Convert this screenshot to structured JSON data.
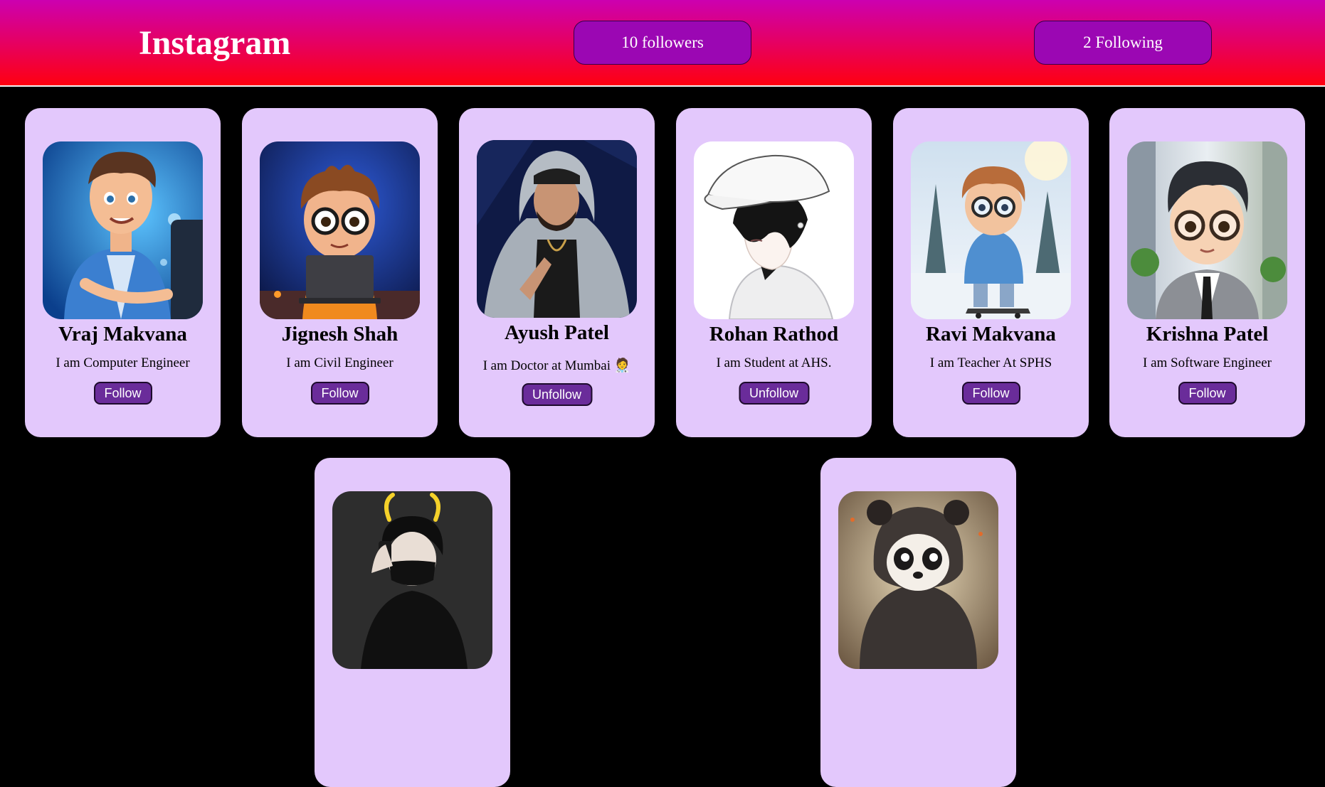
{
  "header": {
    "brand": "Instagram",
    "followers_label": "10 followers",
    "following_label": "2 Following",
    "gradient_top": "#cc00b0",
    "gradient_bottom": "#ff0010",
    "button_color": "#9b07b3"
  },
  "colors": {
    "page_background": "#000000",
    "card_background": "#e3c8fc",
    "action_button": "#6a2c9a"
  },
  "profiles": [
    {
      "name": "Vraj Makvana",
      "bio": "I am Computer Engineer",
      "action": "Follow",
      "avatar": "cartoon-man-laptop-avatar"
    },
    {
      "name": "Jignesh Shah",
      "bio": "I am Civil Engineer",
      "action": "Follow",
      "avatar": "cartoon-boy-glasses-laptop-avatar"
    },
    {
      "name": "Ayush Patel",
      "bio": "I am Doctor at Mumbai 🧑‍⚕️",
      "action": "Unfollow",
      "avatar": "man-grey-hoodie-cap-avatar"
    },
    {
      "name": "Rohan Rathod",
      "bio": "I am Student at AHS.",
      "action": "Unfollow",
      "avatar": "anime-boy-white-cap-avatar"
    },
    {
      "name": "Ravi Makvana",
      "bio": "I am Teacher At SPHS",
      "action": "Follow",
      "avatar": "cartoon-boy-skateboard-snow-avatar"
    },
    {
      "name": "Krishna Patel",
      "bio": "I am Software Engineer",
      "action": "Follow",
      "avatar": "cartoon-boy-suit-glasses-avatar"
    },
    {
      "name": "",
      "bio": "",
      "action": "",
      "avatar": "anime-boy-horns-mask-avatar"
    },
    {
      "name": "",
      "bio": "",
      "action": "",
      "avatar": "cartoon-panda-hoodie-avatar"
    }
  ]
}
